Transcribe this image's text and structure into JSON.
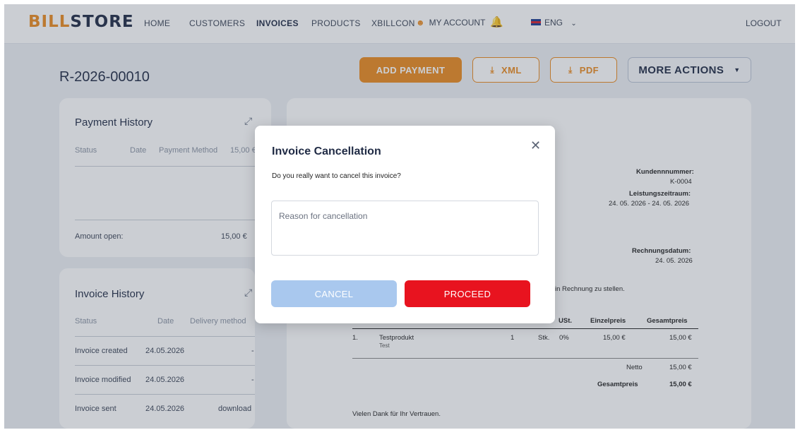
{
  "nav": {
    "logo_part1": "BILL",
    "logo_part2": "STORE",
    "links": [
      "HOME",
      "CUSTOMERS",
      "INVOICES",
      "PRODUCTS",
      "XBILLCON"
    ],
    "my_account": "MY ACCOUNT",
    "language": "ENG",
    "logout": "LOGOUT"
  },
  "header": {
    "invoice_number": "R-2026-00010",
    "add_payment": "ADD PAYMENT",
    "xml": "XML",
    "pdf": "PDF",
    "more_actions": "MORE ACTIONS"
  },
  "payment_history": {
    "title": "Payment History",
    "columns": [
      "Status",
      "Date",
      "Payment Method",
      "15,00 €"
    ],
    "amount_open_label": "Amount open:",
    "amount_open_value": "15,00 €"
  },
  "invoice_history": {
    "title": "Invoice History",
    "columns": [
      "Status",
      "Date",
      "Delivery method"
    ],
    "rows": [
      {
        "status": "Invoice created",
        "date": "24.05.2026",
        "method": "-"
      },
      {
        "status": "Invoice modified",
        "date": "24.05.2026",
        "method": "-"
      },
      {
        "status": "Invoice sent",
        "date": "24.05.2026",
        "method": "download"
      }
    ]
  },
  "invoice_preview": {
    "kundennummer_label": "Kundennnummer:",
    "kundennummer": "K-0004",
    "leistungszeitraum_label": "Leistungszeitraum:",
    "leistungszeitraum": "24. 05. 2026  -  24. 05. 2026",
    "rechnungsdatum_label": "Rechnungsdatum:",
    "rechnungsdatum": "24. 05. 2026",
    "intro_text": "in Rechnung zu stellen.",
    "table_headers": [
      "USt.",
      "Einzelpreis",
      "Gesamtpreis"
    ],
    "item": {
      "pos": "1.",
      "name": "Testprodukt",
      "desc": "Test",
      "qty": "1",
      "unit": "Stk.",
      "tax": "0%",
      "unit_price": "15,00 €",
      "total": "15,00 €"
    },
    "netto_label": "Netto",
    "netto": "15,00 €",
    "gesamt_label": "Gesamtpreis",
    "gesamt": "15,00 €",
    "thanks": "Vielen Dank für Ihr Vertrauen."
  },
  "modal": {
    "title": "Invoice Cancellation",
    "question": "Do you really want to cancel this invoice?",
    "reason_placeholder": "Reason for cancellation",
    "cancel": "CANCEL",
    "proceed": "PROCEED"
  },
  "colors": {
    "accent": "#ea8a1e",
    "danger": "#e8131f",
    "cancel_blue": "#a9c8ee"
  }
}
